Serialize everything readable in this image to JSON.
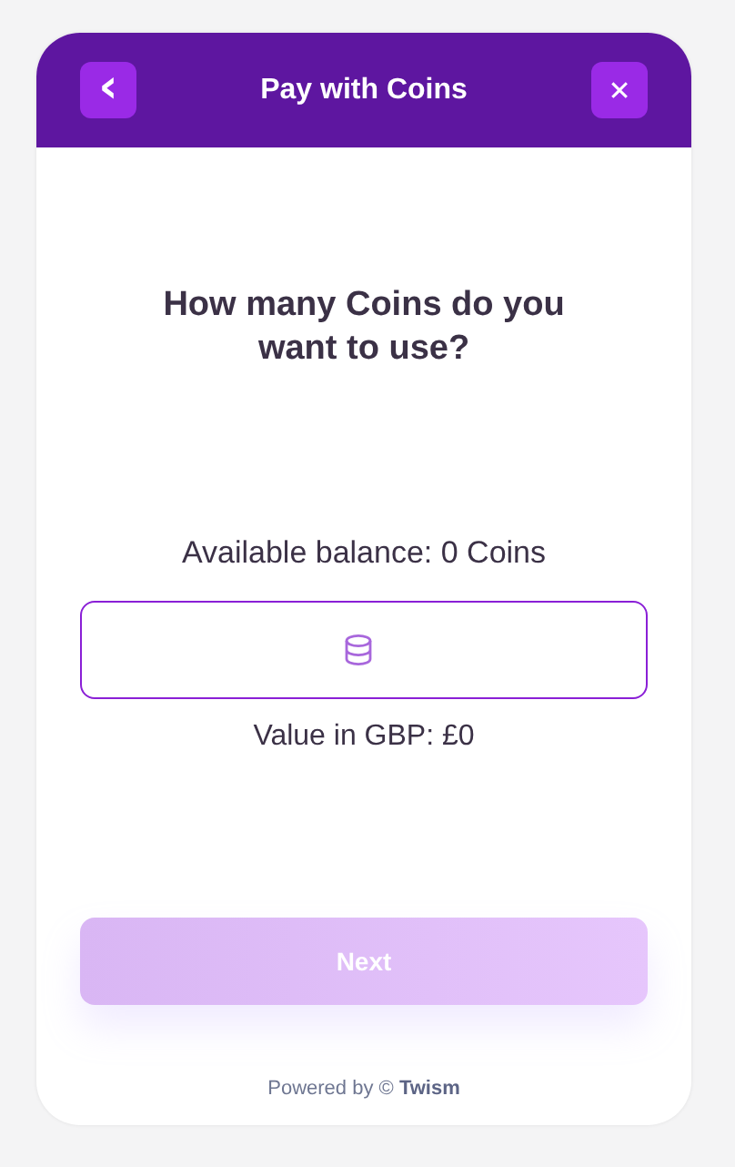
{
  "header": {
    "back_icon_button": "‹",
    "title": "Pay with Coins",
    "close_button": "✕"
  },
  "question": "How many Coins do you want to use?",
  "balance": "Available balance: 0 Coins",
  "value_in_gbp": "Value in GBP: £0",
  "next_button": {
    "label": "Next",
    "disabled": true
  },
  "footer": "Powered by © **Twism**"
}
